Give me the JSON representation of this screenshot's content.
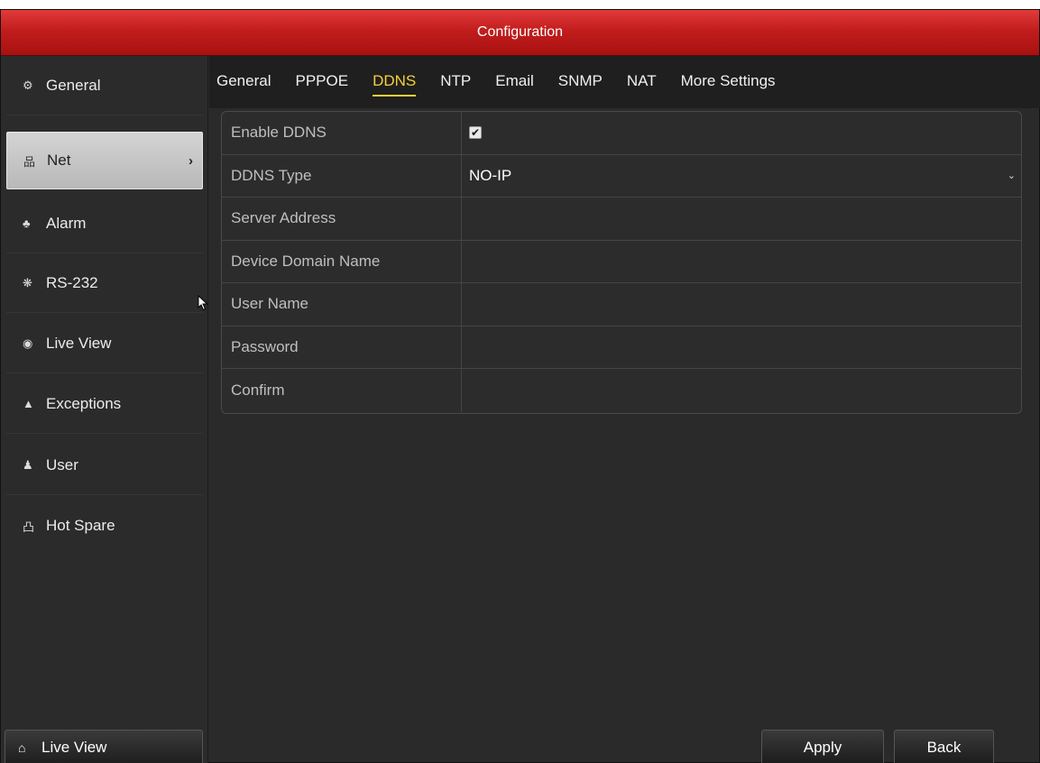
{
  "window": {
    "title": "Configuration"
  },
  "sidebar": {
    "items": [
      {
        "label": "General",
        "icon": "gear-icon",
        "glyph": "⚙"
      },
      {
        "label": "Net",
        "icon": "network-icon",
        "glyph": "品",
        "arrow": "›"
      },
      {
        "label": "Alarm",
        "icon": "alarm-bell-icon",
        "glyph": "♣"
      },
      {
        "label": "RS-232",
        "icon": "serial-port-icon",
        "glyph": "❋"
      },
      {
        "label": "Live View",
        "icon": "eye-icon",
        "glyph": "◉"
      },
      {
        "label": "Exceptions",
        "icon": "warning-icon",
        "glyph": "▲"
      },
      {
        "label": "User",
        "icon": "users-icon",
        "glyph": "♟"
      },
      {
        "label": "Hot Spare",
        "icon": "hot-spare-icon",
        "glyph": "凸"
      }
    ],
    "active_index": 1,
    "live_view_button": {
      "label": "Live View",
      "icon": "home-icon",
      "glyph": "⌂"
    }
  },
  "tabs": {
    "items": [
      "General",
      "PPPOE",
      "DDNS",
      "NTP",
      "Email",
      "SNMP",
      "NAT",
      "More Settings"
    ],
    "active_index": 2
  },
  "form": {
    "enable_ddns": {
      "label": "Enable DDNS",
      "checked": true,
      "check_glyph": "✔"
    },
    "ddns_type": {
      "label": "DDNS Type",
      "value": "NO-IP",
      "dropdown_glyph": "⌄"
    },
    "server_address": {
      "label": "Server Address",
      "value": ""
    },
    "device_domain_name": {
      "label": "Device Domain Name",
      "value": ""
    },
    "user_name": {
      "label": "User Name",
      "value": ""
    },
    "password": {
      "label": "Password",
      "value": ""
    },
    "confirm": {
      "label": "Confirm",
      "value": ""
    }
  },
  "buttons": {
    "apply": "Apply",
    "back": "Back"
  },
  "colors": {
    "title_red": "#c21d1d",
    "active_tab": "#f5d13a",
    "background": "#2a2a2a"
  }
}
